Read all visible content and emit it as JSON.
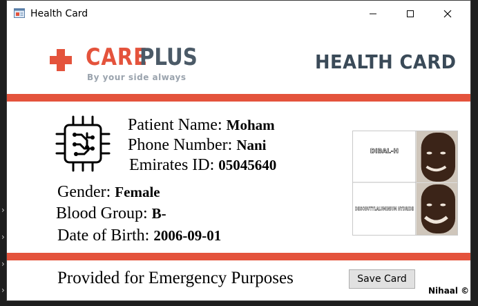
{
  "window": {
    "title": "Health Card",
    "minimize_icon": "minimize-icon",
    "maximize_icon": "maximize-icon",
    "close_icon": "close-icon"
  },
  "header": {
    "logo_care": "CARE",
    "logo_plus": "PLUS",
    "logo_tagline": "By your side always",
    "card_title": "HEALTH CARD"
  },
  "patient": {
    "name_label": "Patient Name:",
    "name_value": "Moham",
    "phone_label": "Phone Number:",
    "phone_value": "Nani",
    "eid_label": "Emirates ID:",
    "eid_value": "05045640",
    "gender_label": "Gender:",
    "gender_value": "Female",
    "blood_label": "Blood Group:",
    "blood_value": "B-",
    "dob_label": "Date of Birth:",
    "dob_value": "2006-09-01"
  },
  "photo": {
    "top_caption": "DIBAL-H",
    "bottom_caption": "DIISOBUTYLALUMINIUM HYDRIDE"
  },
  "footer": {
    "notice": "Provided for Emergency Purposes",
    "save_label": "Save Card",
    "credit": "Nihaal ©"
  },
  "colors": {
    "accent": "#e4533c",
    "brand_dark": "#4b5a67"
  }
}
